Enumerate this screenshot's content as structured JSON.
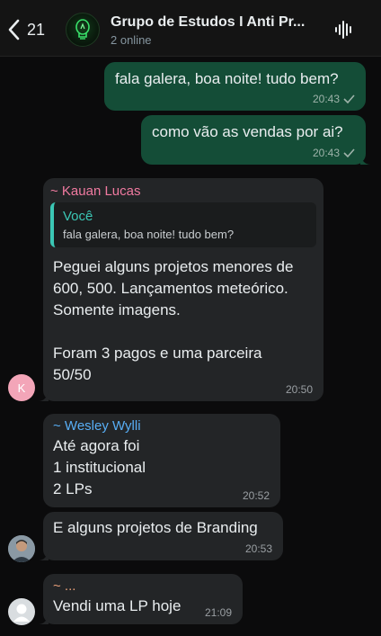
{
  "header": {
    "back_count": "21",
    "group_name": "Grupo de Estudos I Anti Pr...",
    "status": "2 online"
  },
  "messages": [
    {
      "type": "out",
      "text": "fala galera, boa noite! tudo bem?",
      "time": "20:43"
    },
    {
      "type": "out",
      "text": "como vão as vendas por ai?",
      "time": "20:43"
    },
    {
      "type": "in",
      "sender": "~ Kauan Lucas",
      "sender_color": "#f07aa0",
      "quote_author": "Você",
      "quote_text": "fala galera, boa noite! tudo bem?",
      "text_line1": "Peguei alguns projetos menores de",
      "text_line2": "600, 500. Lançamentos meteórico.",
      "text_line3": "Somente imagens.",
      "text_line4": "Foram 3 pagos e uma parceira",
      "text_line5": "50/50",
      "time": "20:50",
      "avatar_initial": "K"
    },
    {
      "type": "in",
      "sender": "~ Wesley Wylli",
      "sender_color": "#58aef5",
      "text_line1": "Até agora foi",
      "text_line2": "1 institucional",
      "text_line3": "2 LPs",
      "time": "20:52"
    },
    {
      "type": "in",
      "text": "E alguns projetos de Branding",
      "time": "20:53"
    },
    {
      "type": "in",
      "sender": "~ ...",
      "sender_color": "#e8a07a",
      "text": "Vendi uma LP hoje",
      "time": "21:09"
    }
  ],
  "icons": {
    "back": "chevron-left-icon",
    "wave": "audio-wave-icon",
    "check": "check-icon"
  },
  "colors": {
    "outgoing_bubble": "#144d37",
    "incoming_bubble": "#232527",
    "quote_accent": "#3bc7b5"
  }
}
